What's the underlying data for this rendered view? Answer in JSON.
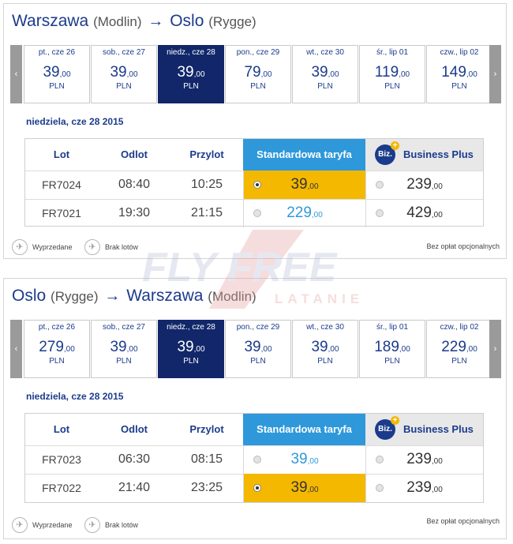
{
  "outbound": {
    "route": {
      "from": "Warszawa",
      "from_sub": "(Modlin)",
      "arrow": "→",
      "to": "Oslo",
      "to_sub": "(Rygge)"
    },
    "nav": {
      "prev": "‹",
      "next": "›"
    },
    "days": [
      {
        "label": "pt., cze 26",
        "price": "39",
        "cents": ",00",
        "currency": "PLN"
      },
      {
        "label": "sob., cze 27",
        "price": "39",
        "cents": ",00",
        "currency": "PLN"
      },
      {
        "label": "niedz., cze 28",
        "price": "39",
        "cents": ",00",
        "currency": "PLN",
        "selected": true
      },
      {
        "label": "pon., cze 29",
        "price": "79",
        "cents": ",00",
        "currency": "PLN"
      },
      {
        "label": "wt., cze 30",
        "price": "39",
        "cents": ",00",
        "currency": "PLN"
      },
      {
        "label": "śr., lip 01",
        "price": "119",
        "cents": ",00",
        "currency": "PLN"
      },
      {
        "label": "czw., lip 02",
        "price": "149",
        "cents": ",00",
        "currency": "PLN"
      }
    ],
    "day_heading": "niedziela, cze 28 2015",
    "table": {
      "headers": {
        "flight": "Lot",
        "depart": "Odlot",
        "arrive": "Przylot",
        "standard": "Standardowa taryfa",
        "biz_logo": "Biz.",
        "business": "Business Plus"
      },
      "rows": [
        {
          "flight": "FR7024",
          "depart": "08:40",
          "arrive": "10:25",
          "std_price": "39",
          "std_cents": ",00",
          "biz_price": "239",
          "biz_cents": ",00"
        },
        {
          "flight": "FR7021",
          "depart": "19:30",
          "arrive": "21:15",
          "std_price": "229",
          "std_cents": ",00",
          "biz_price": "429",
          "biz_cents": ",00"
        }
      ]
    },
    "legend": {
      "sold_out": "Wyprzedane",
      "no_flights": "Brak lotów",
      "note": "Bez opłat opcjonalnych"
    }
  },
  "return": {
    "route": {
      "from": "Oslo",
      "from_sub": "(Rygge)",
      "arrow": "→",
      "to": "Warszawa",
      "to_sub": "(Modlin)"
    },
    "nav": {
      "prev": "‹",
      "next": "›"
    },
    "days": [
      {
        "label": "pt., cze 26",
        "price": "279",
        "cents": ",00",
        "currency": "PLN"
      },
      {
        "label": "sob., cze 27",
        "price": "39",
        "cents": ",00",
        "currency": "PLN"
      },
      {
        "label": "niedz., cze 28",
        "price": "39",
        "cents": ",00",
        "currency": "PLN",
        "selected": true
      },
      {
        "label": "pon., cze 29",
        "price": "39",
        "cents": ",00",
        "currency": "PLN"
      },
      {
        "label": "wt., cze 30",
        "price": "39",
        "cents": ",00",
        "currency": "PLN"
      },
      {
        "label": "śr., lip 01",
        "price": "189",
        "cents": ",00",
        "currency": "PLN"
      },
      {
        "label": "czw., lip 02",
        "price": "229",
        "cents": ",00",
        "currency": "PLN"
      }
    ],
    "day_heading": "niedziela, cze 28 2015",
    "table": {
      "headers": {
        "flight": "Lot",
        "depart": "Odlot",
        "arrive": "Przylot",
        "standard": "Standardowa taryfa",
        "biz_logo": "Biz.",
        "business": "Business Plus"
      },
      "rows": [
        {
          "flight": "FR7023",
          "depart": "06:30",
          "arrive": "08:15",
          "std_price": "39",
          "std_cents": ",00",
          "biz_price": "239",
          "biz_cents": ",00"
        },
        {
          "flight": "FR7022",
          "depart": "21:40",
          "arrive": "23:25",
          "std_price": "39",
          "std_cents": ",00",
          "biz_price": "239",
          "biz_cents": ",00"
        }
      ]
    },
    "legend": {
      "sold_out": "Wyprzedane",
      "no_flights": "Brak lotów",
      "note": "Bez opłat opcjonalnych"
    }
  },
  "watermark": {
    "top": "FLY FREE",
    "bottom": "LATANIE"
  },
  "colors": {
    "navy": "#1b3b8c",
    "selected_day": "#11276a",
    "standard_header": "#2e98da",
    "chosen_fare": "#f4b800",
    "watermark": "#e8a0a0"
  }
}
